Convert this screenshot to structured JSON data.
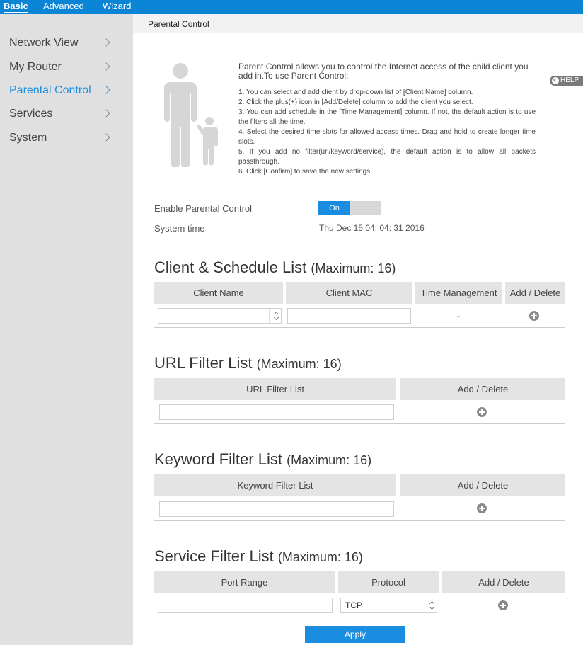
{
  "topnav": {
    "tabs": [
      "Basic",
      "Advanced",
      "Wizard"
    ]
  },
  "sidebar": {
    "items": [
      "Network View",
      "My Router",
      "Parental Control",
      "Services",
      "System"
    ]
  },
  "breadcrumb": "Parental Control",
  "intro": {
    "text": "Parent Control allows you to control the Internet access of the child client you add in.To use Parent Control:",
    "steps": [
      "1. You can select and add client by drop-down list of [Client Name] column.",
      "2. Click the plus(+) icon in [Add/Delete] column to add the client you select.",
      "3. You can add schedule in the [Time Management] column. If not, the default action is to use the filters all the time.",
      "4. Select the desired time slots for allowed access times. Drag and hold to create longer time slots.",
      "5. If you add no filter(url/keyword/service), the default action is to allow all packets passthrough.",
      "6. Click [Confirm] to save the new settings."
    ]
  },
  "help": {
    "label": "HELP"
  },
  "settings": {
    "enable_label": "Enable Parental Control",
    "toggle_on": "On",
    "system_time_label": "System time",
    "system_time_value": "Thu Dec 15 04: 04: 31 2016"
  },
  "client_list": {
    "title": "Client & Schedule List",
    "max": "(Maximum: 16)",
    "headers": [
      "Client Name",
      "Client MAC",
      "Time Management",
      "Add / Delete"
    ],
    "client_name_value": "",
    "client_mac_value": "",
    "time_mgmt_value": "-"
  },
  "url_list": {
    "title": "URL Filter List",
    "max": "(Maximum: 16)",
    "headers": [
      "URL Filter List",
      "Add / Delete"
    ],
    "input_value": ""
  },
  "keyword_list": {
    "title": "Keyword Filter List",
    "max": "(Maximum: 16)",
    "headers": [
      "Keyword Filter List",
      "Add / Delete"
    ],
    "input_value": ""
  },
  "service_list": {
    "title": "Service Filter List",
    "max": "(Maximum: 16)",
    "headers": [
      "Port Range",
      "Protocol",
      "Add / Delete"
    ],
    "port_value": "",
    "protocol_value": "TCP"
  },
  "apply_label": "Apply",
  "colors": {
    "accent": "#1a8de0",
    "topbar": "#0a85d6",
    "sidebar": "#e0e0e0"
  }
}
